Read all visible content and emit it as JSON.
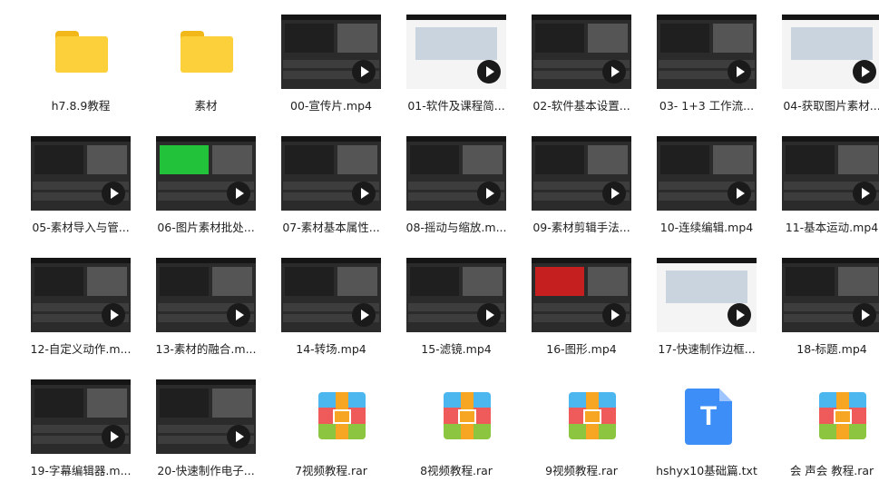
{
  "files": [
    {
      "name": "h7.8.9教程",
      "type": "folder"
    },
    {
      "name": "素材",
      "type": "folder"
    },
    {
      "name": "00-宣传片.mp4",
      "type": "video",
      "theme": "dark"
    },
    {
      "name": "01-软件及课程简...",
      "type": "video",
      "theme": "light"
    },
    {
      "name": "02-软件基本设置...",
      "type": "video",
      "theme": "dark"
    },
    {
      "name": "03- 1+3 工作流...",
      "type": "video",
      "theme": "dark"
    },
    {
      "name": "04-获取图片素材...",
      "type": "video",
      "theme": "light"
    },
    {
      "name": "05-素材导入与管...",
      "type": "video",
      "theme": "dark"
    },
    {
      "name": "06-图片素材批处...",
      "type": "video",
      "theme": "green"
    },
    {
      "name": "07-素材基本属性...",
      "type": "video",
      "theme": "dark"
    },
    {
      "name": "08-摇动与缩放.m...",
      "type": "video",
      "theme": "dark"
    },
    {
      "name": "09-素材剪辑手法...",
      "type": "video",
      "theme": "dark"
    },
    {
      "name": "10-连续编辑.mp4",
      "type": "video",
      "theme": "dark"
    },
    {
      "name": "11-基本运动.mp4",
      "type": "video",
      "theme": "dark"
    },
    {
      "name": "12-自定义动作.m...",
      "type": "video",
      "theme": "dark"
    },
    {
      "name": "13-素材的融合.m...",
      "type": "video",
      "theme": "dark"
    },
    {
      "name": "14-转场.mp4",
      "type": "video",
      "theme": "dark"
    },
    {
      "name": "15-滤镜.mp4",
      "type": "video",
      "theme": "dark"
    },
    {
      "name": "16-图形.mp4",
      "type": "video",
      "theme": "red"
    },
    {
      "name": "17-快速制作边框...",
      "type": "video",
      "theme": "light"
    },
    {
      "name": "18-标题.mp4",
      "type": "video",
      "theme": "dark"
    },
    {
      "name": "19-字幕编辑器.m...",
      "type": "video",
      "theme": "dark"
    },
    {
      "name": "20-快速制作电子...",
      "type": "video",
      "theme": "dark"
    },
    {
      "name": "7视频教程.rar",
      "type": "rar"
    },
    {
      "name": "8视频教程.rar",
      "type": "rar"
    },
    {
      "name": "9视频教程.rar",
      "type": "rar"
    },
    {
      "name": "hshyx10基础篇.txt",
      "type": "txt",
      "glyph": "T"
    },
    {
      "name": "会 声会 教程.rar",
      "type": "rar"
    }
  ],
  "colors": {
    "folder": "#fcd03a",
    "rar_blue": "#4cb6ef",
    "rar_red": "#ef5b5b",
    "rar_green": "#8cc540",
    "txt_blue": "#3e8ef7"
  }
}
